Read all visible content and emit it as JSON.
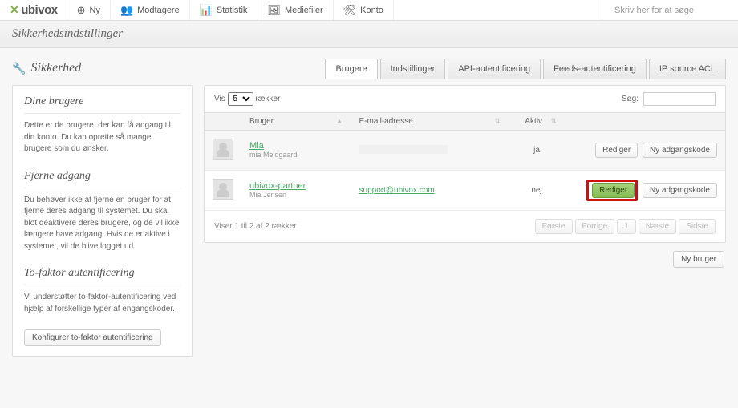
{
  "logo_text": "ubivox",
  "nav": [
    {
      "icon": "+",
      "label": "Ny"
    },
    {
      "icon": "👥",
      "label": "Modtagere"
    },
    {
      "icon": "📈",
      "label": "Statistik"
    },
    {
      "icon": "🖼",
      "label": "Mediefiler"
    },
    {
      "icon": "🛠",
      "label": "Konto"
    }
  ],
  "search_placeholder": "Skriv her for at søge",
  "page_subtitle": "Sikkerhedsindstillinger",
  "page_title": "Sikkerhed",
  "tabs": [
    "Brugere",
    "Indstillinger",
    "API-autentificering",
    "Feeds-autentificering",
    "IP source ACL"
  ],
  "active_tab_index": 0,
  "sidebar": [
    {
      "heading": "Dine brugere",
      "body": "Dette er de brugere, der kan få adgang til din konto. Du kan oprette så mange brugere som du ønsker."
    },
    {
      "heading": "Fjerne adgang",
      "body": "Du behøver ikke at fjerne en bruger for at fjerne deres adgang til systemet. Du skal blot deaktivere deres brugere, og de vil ikke længere have adgang. Hvis de er aktive i systemet, vil de blive logget ud."
    },
    {
      "heading": "To-faktor autentificering",
      "body": "Vi understøtter to-faktor-autentificering ved hjælp af forskellige typer af engangskoder."
    }
  ],
  "sidebar_button": "Konfigurer to-faktor autentificering",
  "table_ctrl": {
    "show": "Vis",
    "rows": "rækker",
    "count": "5",
    "search_label": "Søg:"
  },
  "columns": [
    "Bruger",
    "E-mail-adresse",
    "Aktiv",
    ""
  ],
  "rows": [
    {
      "name": "Mia",
      "sub": "mia Meldgaard",
      "email_hidden": true,
      "email": "",
      "active": "ja",
      "edit": "Rediger",
      "pw": "Ny adgangskode",
      "highlight": false
    },
    {
      "name": "ubivox-partner",
      "sub": "Mia Jensen",
      "email_hidden": false,
      "email": "support@ubivox.com",
      "active": "nej",
      "edit": "Rediger",
      "pw": "Ny adgangskode",
      "highlight": true
    }
  ],
  "footer_showing": "Viser 1 til 2 af 2 rækker",
  "pager": [
    "Første",
    "Forrige",
    "1",
    "Næste",
    "Sidste"
  ],
  "new_user": "Ny bruger"
}
